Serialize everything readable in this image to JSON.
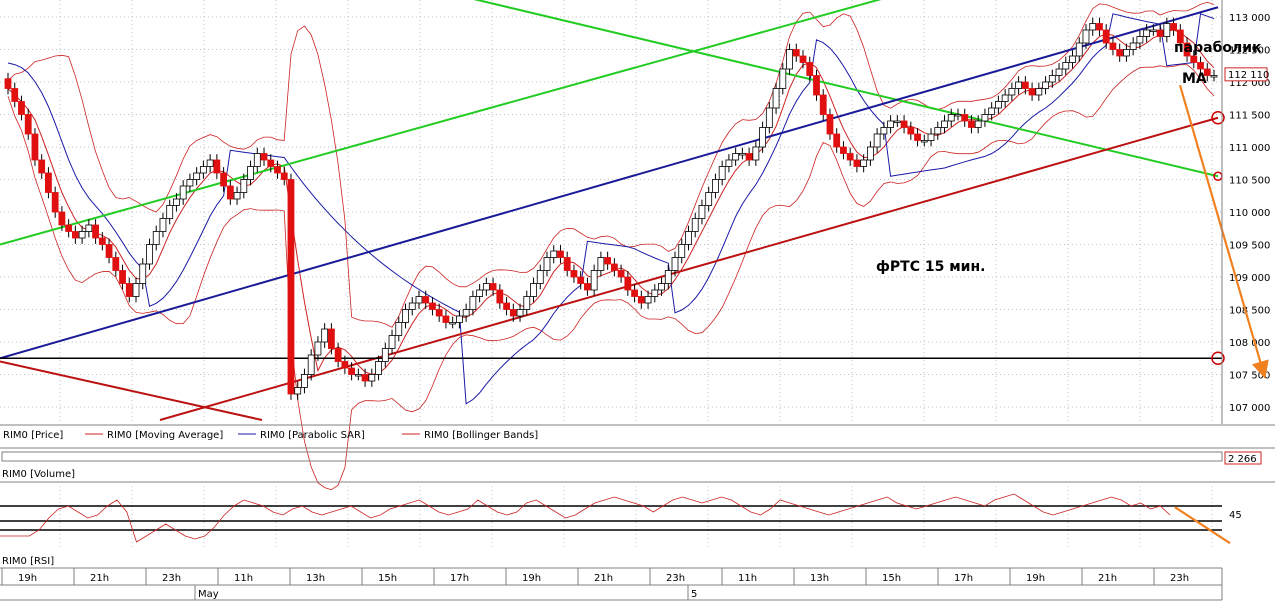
{
  "chart_data": [
    {
      "type": "candlestick",
      "panel": "price",
      "price_axis_ticks": [
        107000,
        107500,
        108000,
        108500,
        109000,
        109500,
        110000,
        110500,
        111000,
        111500,
        112000,
        112500,
        113000
      ],
      "tick_labels": [
        "107 000",
        "107 500",
        "108 000",
        "108 500",
        "109 000",
        "109 500",
        "110 000",
        "110 500",
        "111 000",
        "111 500",
        "112 000",
        "112 500",
        "113 000"
      ],
      "ylim": [
        106800,
        113200
      ],
      "last_price_label": "112 110",
      "grid": true,
      "legend": [
        "RIM0 [Price]",
        "RIM0 [Moving Average]",
        "RIM0 [Parabolic SAR]",
        "RIM0 [Bollinger Bands]"
      ],
      "annotations": {
        "parabolic": "параболик",
        "ma": "MA",
        "instrument": "фРТС   15 мин."
      },
      "close_series": [
        111900,
        111700,
        111500,
        111200,
        110800,
        110600,
        110300,
        110000,
        109800,
        109700,
        109600,
        109700,
        109800,
        109600,
        109500,
        109300,
        109100,
        108900,
        108700,
        108900,
        109200,
        109500,
        109700,
        109900,
        110100,
        110200,
        110400,
        110500,
        110600,
        110700,
        110800,
        110600,
        110400,
        110200,
        110300,
        110500,
        110700,
        110900,
        110800,
        110700,
        110600,
        110500,
        107200,
        107300,
        107500,
        107800,
        108000,
        108200,
        107900,
        107700,
        107600,
        107500,
        107500,
        107400,
        107500,
        107700,
        107900,
        108100,
        108300,
        108500,
        108600,
        108700,
        108600,
        108500,
        108400,
        108300,
        108300,
        108400,
        108500,
        108700,
        108800,
        108900,
        108800,
        108600,
        108500,
        108400,
        108500,
        108700,
        108900,
        109100,
        109300,
        109400,
        109300,
        109100,
        109000,
        108900,
        108800,
        109100,
        109300,
        109200,
        109100,
        109000,
        108800,
        108700,
        108600,
        108700,
        108800,
        108900,
        109100,
        109300,
        109500,
        109700,
        109900,
        110100,
        110300,
        110500,
        110700,
        110800,
        110900,
        110900,
        110800,
        111000,
        111300,
        111600,
        111900,
        112200,
        112500,
        112400,
        112300,
        112100,
        111800,
        111500,
        111200,
        111000,
        110900,
        110800,
        110700,
        110800,
        111000,
        111200,
        111300,
        111400,
        111400,
        111300,
        111200,
        111100,
        111100,
        111200,
        111300,
        111400,
        111500,
        111500,
        111400,
        111300,
        111400,
        111500,
        111600,
        111700,
        111800,
        111900,
        112000,
        111900,
        111800,
        111900,
        112000,
        112100,
        112200,
        112300,
        112400,
        112600,
        112800,
        112900,
        112800,
        112600,
        112500,
        112400,
        112500,
        112600,
        112700,
        112800,
        112800,
        112700,
        112900,
        112800,
        112600,
        112400,
        112300,
        112200,
        112100,
        112100
      ],
      "green_line_1": [
        [
          0,
          109500
        ],
        [
          910,
          113400
        ]
      ],
      "green_line_2": [
        [
          440,
          113400
        ],
        [
          1218,
          110550
        ]
      ],
      "blue_line": [
        [
          0,
          107750
        ],
        [
          1218,
          113150
        ]
      ],
      "red_line_top": [
        [
          160,
          106800
        ],
        [
          1218,
          111450
        ]
      ],
      "red_line_bottom": [
        [
          0,
          107700
        ],
        [
          262,
          106800
        ]
      ],
      "black_level": 107750
    },
    {
      "type": "line",
      "panel": "volume",
      "title": "RIM0 [Volume]",
      "value_label": "2 266"
    },
    {
      "type": "line",
      "panel": "rsi",
      "title": "RIM0 [RSI]",
      "level_label": "45",
      "ylim": [
        0,
        100
      ],
      "levels": [
        70,
        45,
        30
      ],
      "values": [
        20,
        20,
        20,
        20,
        30,
        50,
        65,
        70,
        60,
        50,
        55,
        70,
        80,
        60,
        10,
        20,
        30,
        40,
        30,
        20,
        15,
        20,
        35,
        55,
        70,
        80,
        75,
        70,
        60,
        55,
        65,
        70,
        60,
        55,
        60,
        65,
        70,
        60,
        50,
        55,
        65,
        70,
        75,
        80,
        70,
        60,
        55,
        60,
        65,
        80,
        70,
        60,
        55,
        60,
        75,
        80,
        70,
        60,
        50,
        55,
        65,
        75,
        80,
        85,
        80,
        75,
        70,
        60,
        70,
        80,
        85,
        80,
        75,
        80,
        85,
        80,
        70,
        60,
        55,
        65,
        80,
        75,
        70,
        65,
        60,
        55,
        60,
        65,
        70,
        75,
        80,
        85,
        75,
        70,
        65,
        70,
        75,
        80,
        85,
        80,
        75,
        70,
        80,
        85,
        90,
        80,
        70,
        60,
        55,
        60,
        65,
        70,
        75,
        80,
        85,
        80,
        70,
        75,
        65,
        70,
        55
      ]
    }
  ],
  "time_axis": {
    "labels": [
      "19h",
      "21h",
      "23h",
      "11h",
      "13h",
      "15h",
      "17h",
      "19h",
      "21h",
      "23h",
      "11h",
      "13h",
      "15h",
      "17h",
      "19h",
      "21h",
      "23h"
    ],
    "date_labels": [
      "May",
      "5"
    ]
  }
}
